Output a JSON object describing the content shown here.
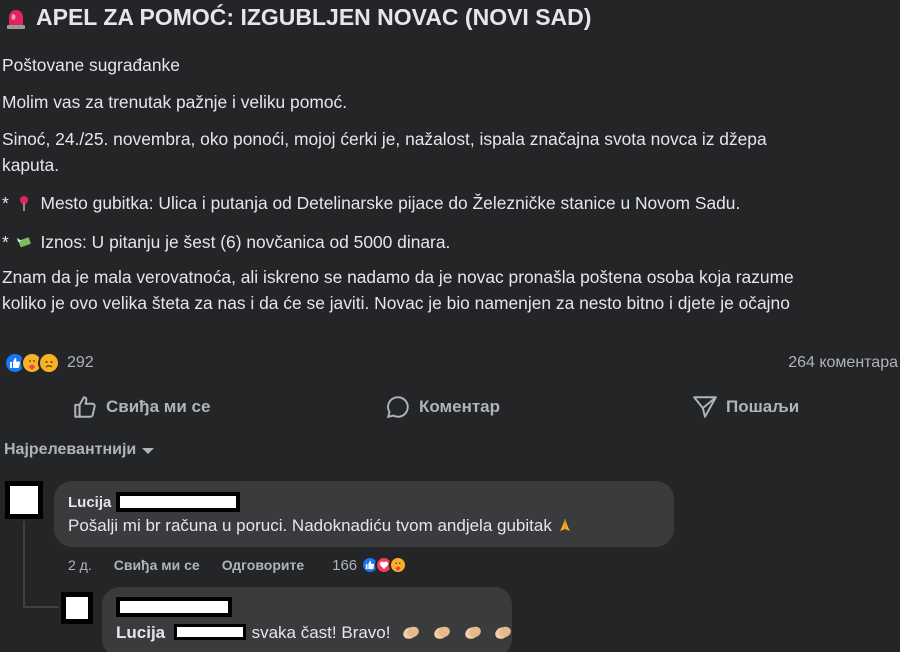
{
  "post": {
    "title": "APEL ZA POMOĆ: IZGUBLJEN NOVAC (NOVI SAD)",
    "title_icon": "siren-icon",
    "greeting": "Poštovane sugrađanke",
    "request": "Molim vas za trenutak pažnje i veliku pomoć.",
    "story_line1": "Sinoć, 24./25. novembra, oko ponoći, mojoj ćerki je, nažalost, ispala značajna svota novca iz džepa",
    "story_line2": "kaputa.",
    "location_prefix": "* ",
    "location_icon": "pin-icon",
    "location_text": "Mesto gubitka: Ulica i putanja od Detelinarske pijace do Železničke stanice u Novom Sadu.",
    "amount_prefix": "* ",
    "amount_icon": "money-wings-icon",
    "amount_text": "Iznos: U pitanju je šest (6) novčanica od 5000 dinara.",
    "closing_line1": "Znam da je mala verovatnoća, ali iskreno se nadamo da je novac pronašla poštena osoba koja razume",
    "closing_line2": "koliko je ovo velika šteta za nas i da će se javiti. Novac je bio namenjen za nesto bitno i djete je očajno"
  },
  "reactions": {
    "count": "292",
    "comments": "264 коментара",
    "types": [
      "like",
      "care",
      "sad"
    ]
  },
  "actions": {
    "like": "Свиђа ми се",
    "comment": "Коментар",
    "share": "Пошаљи"
  },
  "sort": {
    "label": "Најрелевантнији"
  },
  "comments": [
    {
      "author": "Lucija",
      "text": "Pošalji mi br računa u poruci. Nadoknadiću tvom andjela gubitak",
      "text_icon": "pray-icon",
      "age": "2 д.",
      "like_label": "Свиђа ми се",
      "reply_label": "Одговорите",
      "reaction_count": "166",
      "reaction_types": [
        "like",
        "love",
        "care"
      ]
    },
    {
      "mention": "Lucija",
      "text": "svaka čast! Bravo!",
      "text_icons": [
        "clap-icon",
        "clap-icon",
        "clap-icon",
        "clap-icon"
      ]
    }
  ],
  "colors": {
    "background": "#242526",
    "bubble": "#3a3b3c",
    "text": "#e4e6eb",
    "secondary": "#b0b3b8",
    "like_blue": "#1877f2",
    "love_red": "#f33e58",
    "emoji_yellow": "#f7b125"
  }
}
